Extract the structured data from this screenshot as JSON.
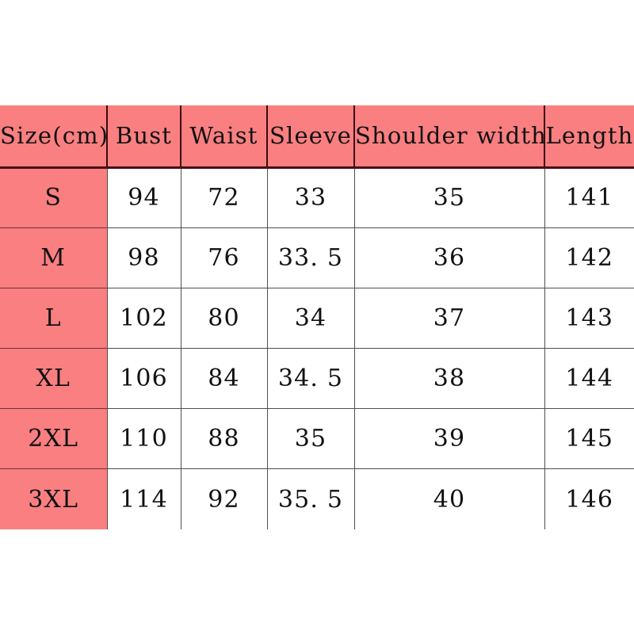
{
  "page": {
    "background_color": "#ffffff",
    "accent_color": "#f97f81",
    "grid_color": "#4f4f4f",
    "header_border_color": "#4a0d14",
    "text_color": "#111111"
  },
  "chart_data": {
    "type": "table",
    "title": "",
    "columns": [
      "Size(cm)",
      "Bust",
      "Waist",
      "Sleeve",
      "Shoulder width",
      "Length"
    ],
    "categories": [
      "S",
      "M",
      "L",
      "XL",
      "2XL",
      "3XL"
    ],
    "rows": [
      [
        "S",
        "94",
        "72",
        "33",
        "35",
        "141"
      ],
      [
        "M",
        "98",
        "76",
        "33. 5",
        "36",
        "142"
      ],
      [
        "L",
        "102",
        "80",
        "34",
        "37",
        "143"
      ],
      [
        "XL",
        "106",
        "84",
        "34. 5",
        "38",
        "144"
      ],
      [
        "2XL",
        "110",
        "88",
        "35",
        "39",
        "145"
      ],
      [
        "3XL",
        "114",
        "92",
        "35. 5",
        "40",
        "146"
      ]
    ],
    "series": [
      {
        "name": "Bust",
        "values": [
          94,
          98,
          102,
          106,
          110,
          114
        ]
      },
      {
        "name": "Waist",
        "values": [
          72,
          76,
          80,
          84,
          88,
          92
        ]
      },
      {
        "name": "Sleeve",
        "values": [
          33,
          33.5,
          34,
          34.5,
          35,
          35.5
        ]
      },
      {
        "name": "Shoulder width",
        "values": [
          35,
          36,
          37,
          38,
          39,
          40
        ]
      },
      {
        "name": "Length",
        "values": [
          141,
          142,
          143,
          144,
          145,
          146
        ]
      }
    ],
    "unit": "cm",
    "xlabel": "",
    "ylabel": ""
  },
  "table": {
    "header": {
      "size": "Size(cm)",
      "bust": "Bust",
      "waist": "Waist",
      "sleeve": "Sleeve",
      "shoulder": "Shoulder width",
      "length": "Length"
    },
    "rows": [
      {
        "size": "S",
        "bust": "94",
        "waist": "72",
        "sleeve": "33",
        "shoulder": "35",
        "length": "141"
      },
      {
        "size": "M",
        "bust": "98",
        "waist": "76",
        "sleeve": "33. 5",
        "shoulder": "36",
        "length": "142"
      },
      {
        "size": "L",
        "bust": "102",
        "waist": "80",
        "sleeve": "34",
        "shoulder": "37",
        "length": "143"
      },
      {
        "size": "XL",
        "bust": "106",
        "waist": "84",
        "sleeve": "34. 5",
        "shoulder": "38",
        "length": "144"
      },
      {
        "size": "2XL",
        "bust": "110",
        "waist": "88",
        "sleeve": "35",
        "shoulder": "39",
        "length": "145"
      },
      {
        "size": "3XL",
        "bust": "114",
        "waist": "92",
        "sleeve": "35. 5",
        "shoulder": "40",
        "length": "146"
      }
    ]
  }
}
